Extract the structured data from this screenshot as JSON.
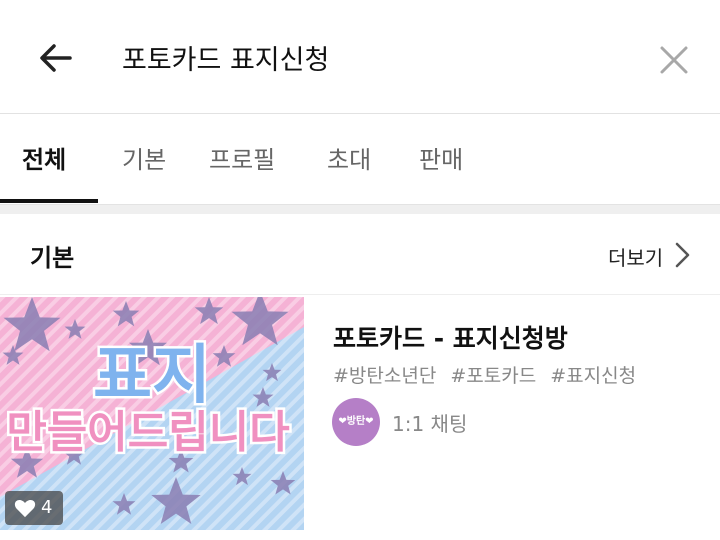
{
  "search": {
    "query": "포토카드 표지신청"
  },
  "tabs": [
    {
      "label": "전체",
      "active": true
    },
    {
      "label": "기본",
      "active": false
    },
    {
      "label": "프로필",
      "active": false
    },
    {
      "label": "초대",
      "active": false
    },
    {
      "label": "판매",
      "active": false
    }
  ],
  "section": {
    "title": "기본",
    "more_label": "더보기"
  },
  "card": {
    "title": "포토카드 - 표지신청방",
    "tags": [
      "#방탄소년단",
      "#포토카드",
      "#표지신청"
    ],
    "thumbnail": {
      "line1": "표지",
      "line2": "만들어드립니다"
    },
    "likes": "4",
    "avatar_text": "❤방탄❤",
    "chat_type": "1:1 채팅"
  },
  "colors": {
    "thumb_pink": "#f7b8d8",
    "thumb_blue": "#b9d8f3",
    "star": "#8a7fb3",
    "avatar": "#b57fc7"
  },
  "icons": {
    "back": "arrow-left-icon",
    "clear": "close-icon",
    "more": "chevron-right-icon",
    "like": "heart-icon"
  }
}
